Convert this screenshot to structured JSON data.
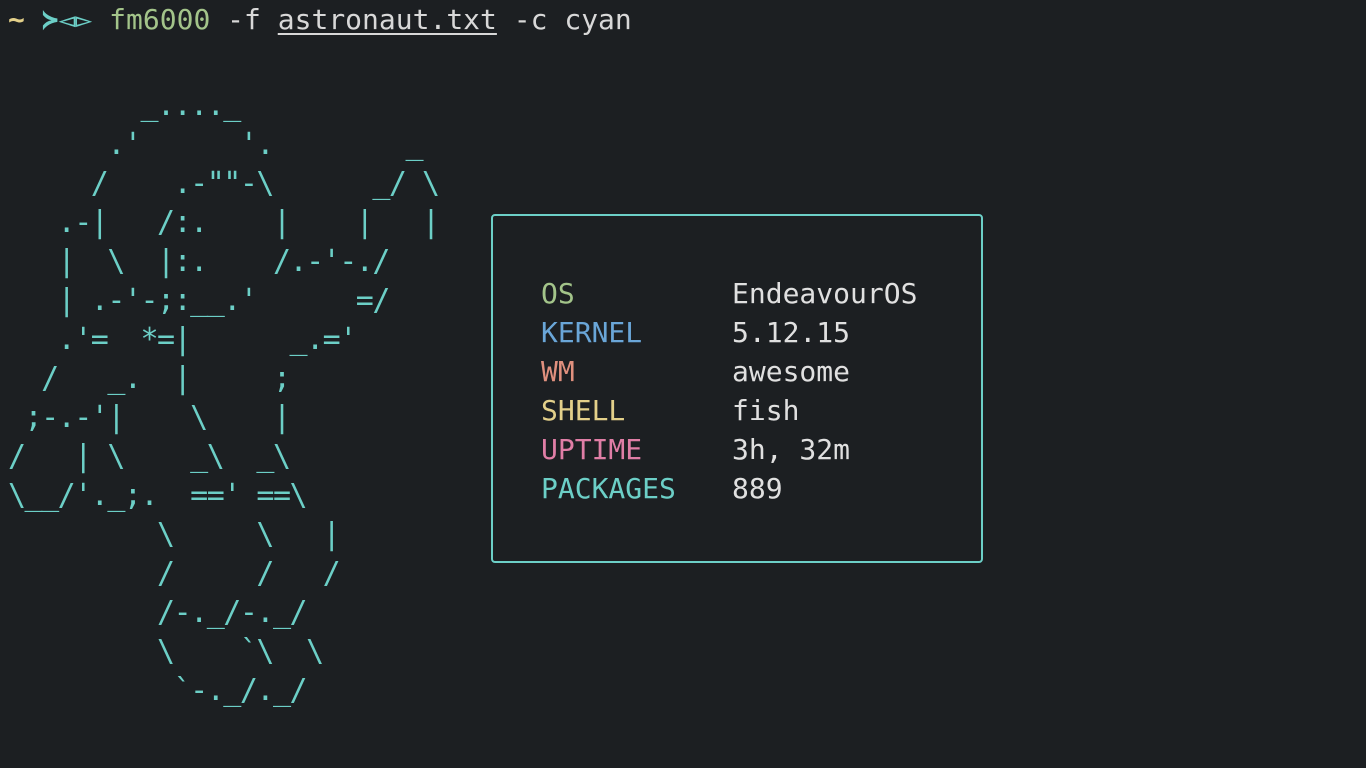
{
  "prompt": {
    "cwd": "~",
    "symbol": "≻◅▻",
    "command": "fm6000",
    "flag_f": " -f ",
    "file": "astronaut.txt",
    "flag_c": " -c cyan"
  },
  "ascii_art": "        _...._\n      .'      '.        _\n     /    .-\"\"-\\      _/ \\\n   .-|   /:.    |    |   |\n   |  \\  |:.    /.-'-./\n   | .-'-;:__.'      =/\n   .'=  *=|      _.='\n  /   _.  |     ;\n ;-.-'|    \\    |\n/   | \\    _\\  _\\\n\\__/'._;.  ==' ==\\\n         \\     \\   |\n         /     /   /\n         /-._/-._/\n         \\    `\\  \\\n          `-._/._/",
  "info": {
    "rows": [
      {
        "key": "OS",
        "value": "EndeavourOS",
        "color": "#a3c48a"
      },
      {
        "key": "KERNEL",
        "value": "5.12.15",
        "color": "#6aa6d8"
      },
      {
        "key": "WM",
        "value": "awesome",
        "color": "#e0907e"
      },
      {
        "key": "SHELL",
        "value": "fish",
        "color": "#e3d08a"
      },
      {
        "key": "UPTIME",
        "value": "3h, 32m",
        "color": "#e07ea6"
      },
      {
        "key": "PACKAGES",
        "value": "889",
        "color": "#6ccfc7"
      }
    ]
  },
  "colors": {
    "background": "#1c1f22",
    "accent": "#6ccfc7",
    "text": "#d8d8d8"
  }
}
